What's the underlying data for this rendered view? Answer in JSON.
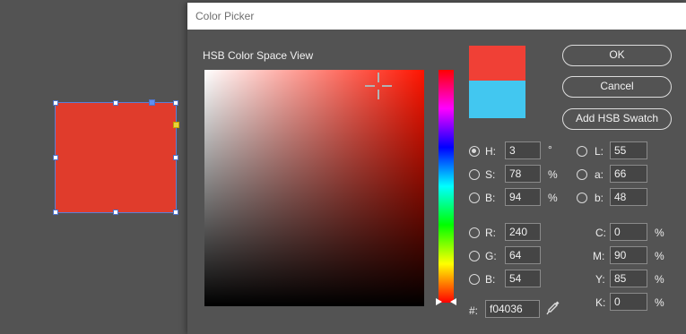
{
  "dialog": {
    "title": "Color Picker",
    "view_label": "HSB Color Space View"
  },
  "colors": {
    "new_color": "#f04036",
    "previous_color": "#42c7f0",
    "canvas_object": "#e03c2c"
  },
  "buttons": {
    "ok": "OK",
    "cancel": "Cancel",
    "add_swatch": "Add HSB Swatch"
  },
  "hsb": {
    "h": {
      "label": "H:",
      "value": "3",
      "unit": "°",
      "selected": true
    },
    "s": {
      "label": "S:",
      "value": "78",
      "unit": "%"
    },
    "b": {
      "label": "B:",
      "value": "94",
      "unit": "%"
    }
  },
  "lab": {
    "l": {
      "label": "L:",
      "value": "55"
    },
    "a": {
      "label": "a:",
      "value": "66"
    },
    "b": {
      "label": "b:",
      "value": "48"
    }
  },
  "rgb": {
    "r": {
      "label": "R:",
      "value": "240"
    },
    "g": {
      "label": "G:",
      "value": "64"
    },
    "b": {
      "label": "B:",
      "value": "54"
    }
  },
  "cmyk": {
    "c": {
      "label": "C:",
      "value": "0",
      "unit": "%"
    },
    "m": {
      "label": "M:",
      "value": "90",
      "unit": "%"
    },
    "y": {
      "label": "Y:",
      "value": "85",
      "unit": "%"
    },
    "k": {
      "label": "K:",
      "value": "0",
      "unit": "%"
    }
  },
  "hex": {
    "label": "#:",
    "value": "f04036"
  },
  "icons": {
    "eyedropper": "eyedropper-icon",
    "crosshair": "crosshair-icon",
    "hue_marker": "hue-slider-marker-icon"
  }
}
